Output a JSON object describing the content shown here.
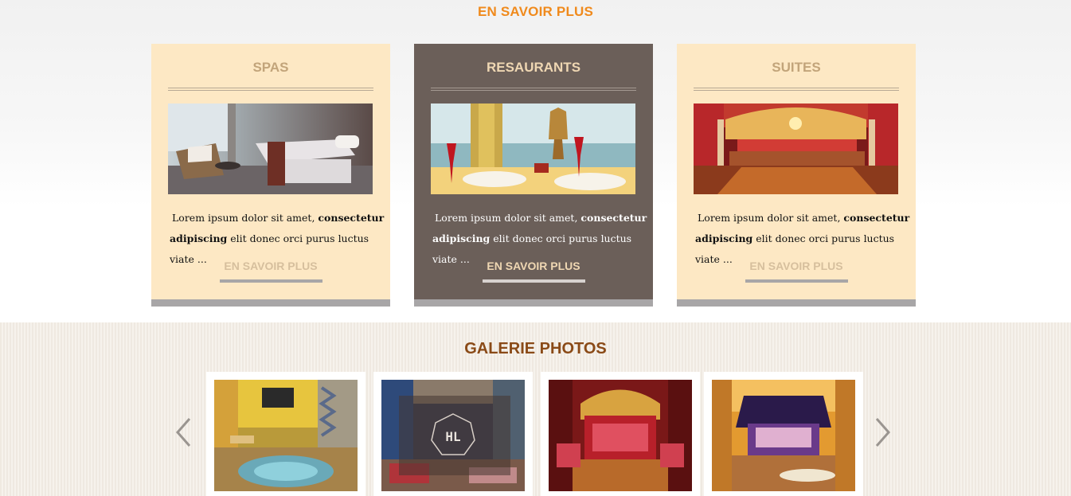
{
  "top_link": "EN SAVOIR PLUS",
  "cards": [
    {
      "title": "SPAS",
      "text_part1": "Lorem ipsum dolor sit amet, ",
      "text_bold1": "consectetur",
      "text_bold2": "adipiscing",
      "text_part2": " elit donec orci purus luctus viate ...",
      "more": "EN SAVOIR PLUS"
    },
    {
      "title": "RESAURANTS",
      "text_part1": "Lorem ipsum dolor sit amet, ",
      "text_bold1": "consectetur",
      "text_bold2": "adipiscing",
      "text_part2": " elit donec orci purus luctus viate ...",
      "more": "EN SAVOIR PLUS"
    },
    {
      "title": "SUITES",
      "text_part1": "Lorem ipsum dolor sit amet, ",
      "text_bold1": "consectetur",
      "text_bold2": "adipiscing",
      "text_part2": " elit donec orci purus luctus viate ...",
      "more": "EN SAVOIR PLUS"
    }
  ],
  "gallery": {
    "title": "GALERIE PHOTOS",
    "overlay_logo": "HL"
  },
  "colors": {
    "accent_orange": "#f08a1c",
    "card_light": "#fde8c4",
    "card_dark": "#6b5f59",
    "gallery_title": "#8a4a17"
  }
}
